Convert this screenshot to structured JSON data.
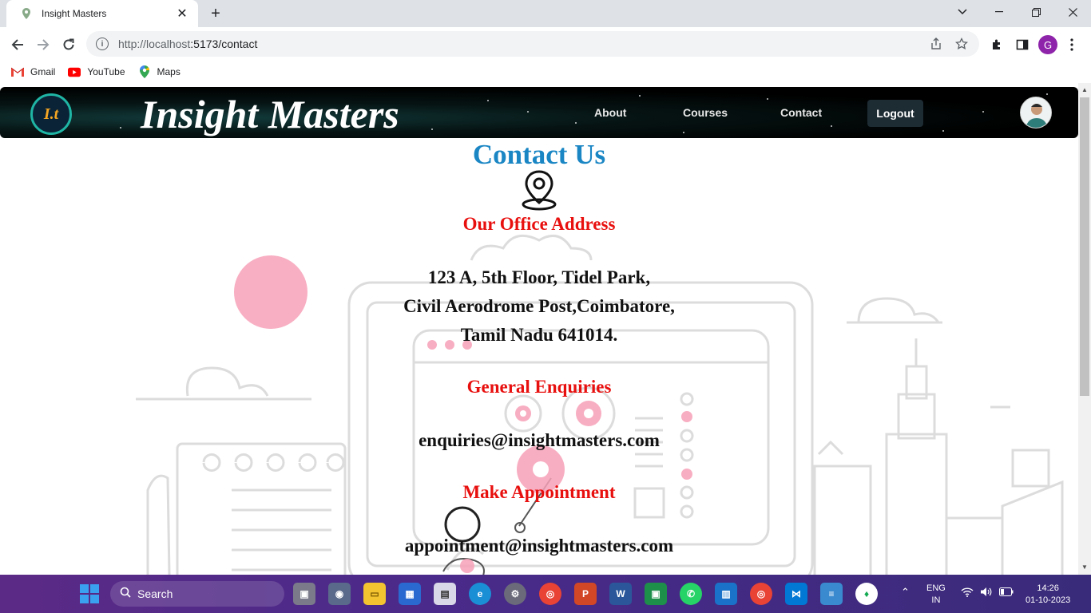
{
  "browser": {
    "tab_title": "Insight Masters",
    "tab_close": "✕",
    "new_tab": "+",
    "url_host": "http://localhost",
    "url_path": ":5173/contact",
    "profile_letter": "G",
    "bookmarks": [
      {
        "label": "Gmail",
        "icon": "gmail-icon"
      },
      {
        "label": "YouTube",
        "icon": "youtube-icon"
      },
      {
        "label": "Maps",
        "icon": "maps-icon"
      }
    ]
  },
  "site": {
    "brand": "Insight Masters",
    "logo_text": "I.t",
    "nav": {
      "about": "About",
      "courses": "Courses",
      "contact": "Contact",
      "logout": "Logout"
    }
  },
  "contact": {
    "heading": "Contact Us",
    "office_title": "Our Office Address",
    "address_line1": "123 A, 5th Floor, Tidel Park,",
    "address_line2": "Civil Aerodrome Post,Coimbatore,",
    "address_line3": "Tamil Nadu 641014.",
    "enquiries_title": "General Enquiries",
    "enquiries_email": "enquiries@insightmasters.com",
    "appointment_title": "Make Appointment",
    "appointment_email": "appointment@insightmasters.com"
  },
  "taskbar": {
    "search_label": "Search",
    "lang_line1": "ENG",
    "lang_line2": "IN",
    "time": "14:26",
    "date": "01-10-2023"
  },
  "colors": {
    "heading_blue": "#1a86c4",
    "section_red": "#e8100f",
    "taskbar_purple": "#4a2a8a"
  }
}
